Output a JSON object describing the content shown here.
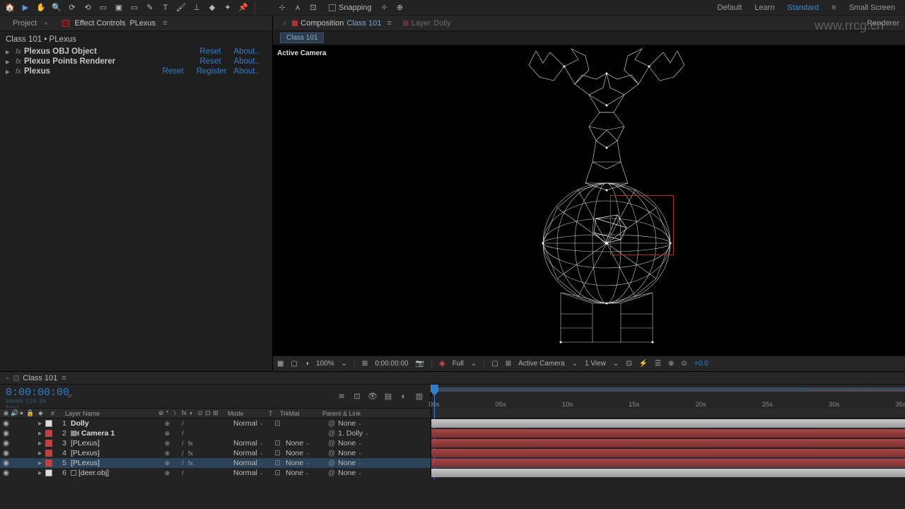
{
  "workspace": {
    "default": "Default",
    "learn": "Learn",
    "standard": "Standard",
    "small": "Small Screen"
  },
  "snapping": {
    "label": "Snapping"
  },
  "watermark": "www.rrcg.cn",
  "tabs": {
    "project": "Project",
    "effect_controls": "Effect Controls",
    "ec_subject": "PLexus"
  },
  "ec": {
    "path": "Class 101 • PLexus",
    "rows": [
      {
        "name": "Plexus OBJ Object",
        "links": [
          "Reset",
          "About.."
        ],
        "bold": true
      },
      {
        "name": "Plexus Points Renderer",
        "links": [
          "Reset",
          "About.."
        ],
        "bold": true
      },
      {
        "name": "Plexus",
        "links": [
          "Reset",
          "Register",
          "About.."
        ],
        "bold": true
      }
    ]
  },
  "comp": {
    "prefix": "Composition",
    "name": "Class 101",
    "layer_tab": "Layer",
    "layer_subject": "Dolly",
    "render_queue": "Renderer",
    "flow": "Class 101",
    "active_camera": "Active Camera"
  },
  "view": {
    "mag": "100%",
    "timecode": "0:00:00:00",
    "res": "Full",
    "cam": "Active Camera",
    "views": "1 View",
    "exposure": "+0.0"
  },
  "timeline": {
    "tab": "Class 101",
    "timecode": "0:00:00:00",
    "sub": "00000 (29.98 fps)",
    "cols": {
      "name": "Layer Name",
      "mode": "Mode",
      "t": "T",
      "trk": "TrkMat",
      "par": "Parent & Link"
    },
    "layers": [
      {
        "num": "1",
        "name": "Dolly",
        "bold": true,
        "label": "white",
        "sw": "⊕  /",
        "mode": "Normal",
        "trk": "",
        "par": "None",
        "icon": ""
      },
      {
        "num": "2",
        "name": "Camera 1",
        "bold": true,
        "label": "red",
        "sw": "⊕",
        "mode": "",
        "trk": "",
        "par": "1. Dolly",
        "icon": "cam"
      },
      {
        "num": "3",
        "name": "[PLexus]",
        "bold": false,
        "label": "red",
        "sw": "⊕  /  fx",
        "mode": "Normal",
        "trk": "None",
        "par": "None",
        "icon": ""
      },
      {
        "num": "4",
        "name": "[PLexus]",
        "bold": false,
        "label": "red",
        "sw": "⊕  /  fx",
        "mode": "Normal",
        "trk": "None",
        "par": "None",
        "icon": ""
      },
      {
        "num": "5",
        "name": "[PLexus]",
        "bold": false,
        "label": "red",
        "sw": "⊕  /  fx",
        "mode": "Normal",
        "trk": "None",
        "par": "None",
        "icon": "",
        "sel": true
      },
      {
        "num": "6",
        "name": "[deer.obj]",
        "bold": false,
        "label": "white",
        "sw": "⊕  /",
        "mode": "Normal",
        "trk": "None",
        "par": "None",
        "icon": "cube"
      }
    ],
    "ticks": [
      "00s",
      "05s",
      "10s",
      "15s",
      "20s",
      "25s",
      "30s",
      "35s"
    ],
    "bar_color": [
      "white",
      "red",
      "red",
      "red",
      "red",
      "white"
    ]
  }
}
